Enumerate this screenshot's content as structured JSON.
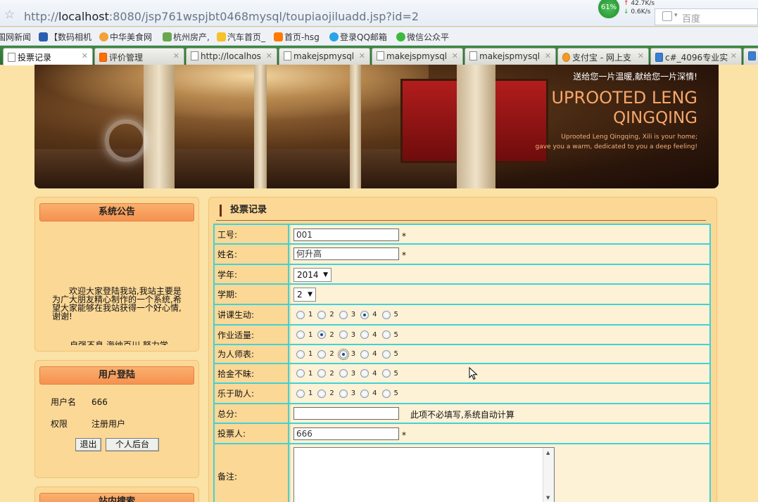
{
  "browser": {
    "url_prefix": "http://",
    "url_host": "localhost",
    "url_rest": ":8080/jsp761wspjbt0468mysql/toupiaojiluadd.jsp?id=2",
    "net_percent": "61%",
    "net_up": "42.7K/s",
    "net_down": "0.6K/s",
    "search_engine": "百度",
    "bookmarks": [
      "国网新闻",
      "【数码相机",
      "中华美食网",
      "杭州房产,",
      "汽车首页_",
      "首页-hsg",
      "登录QQ邮箱",
      "微信公众平"
    ],
    "tabs": [
      "投票记录",
      "评价管理",
      "http://localhos",
      "makejspmysql",
      "makejspmysql",
      "makejspmysql",
      "支付宝 - 网上支",
      "c#_4096专业实"
    ]
  },
  "banner": {
    "slogan": "送给您一片温暖,献给您一片深情!",
    "title_line1": "UPROOTED LENG",
    "title_line2": "QINGQING",
    "caption_line1": "Uprooted Leng Qingqing, Xili is your home;",
    "caption_line2": "gave you a warm, dedicated to you a deep feeling!"
  },
  "sidebar": {
    "notice_title": "系统公告",
    "notice_text": "欢迎大家登陆我站,我站主要是为广大朋友精心制作的一个系统,希望大家能够在我站获得一个好心情,谢谢!",
    "notice_text2": "自强不息,海纳百川,努力学",
    "login_title": "用户登陆",
    "username_label": "用户名",
    "username_value": "666",
    "role_label": "权限",
    "role_value": "注册用户",
    "logout_label": "退出",
    "backend_label": "个人后台",
    "search_title": "站内搜索"
  },
  "form": {
    "title": "投票记录",
    "required_mark": "*",
    "fields": {
      "gonghao_label": "工号:",
      "gonghao_value": "001",
      "name_label": "姓名:",
      "name_value": "何升高",
      "year_label": "学年:",
      "year_value": "2014",
      "term_label": "学期:",
      "term_value": "2",
      "lecture_label": "讲课生动:",
      "homework_label": "作业适量:",
      "model_label": "为人师表:",
      "honest_label": "拾金不昧:",
      "helpful_label": "乐于助人:",
      "total_label": "总分:",
      "total_value": "",
      "total_note": "此项不必填写,系统自动计算",
      "voter_label": "投票人:",
      "voter_value": "666",
      "remark_label": "备注:"
    },
    "rating_options": [
      "1",
      "2",
      "3",
      "4",
      "5"
    ],
    "ratings": {
      "lecture": "4",
      "homework": "2",
      "model": "3",
      "honest": "",
      "helpful": ""
    }
  }
}
